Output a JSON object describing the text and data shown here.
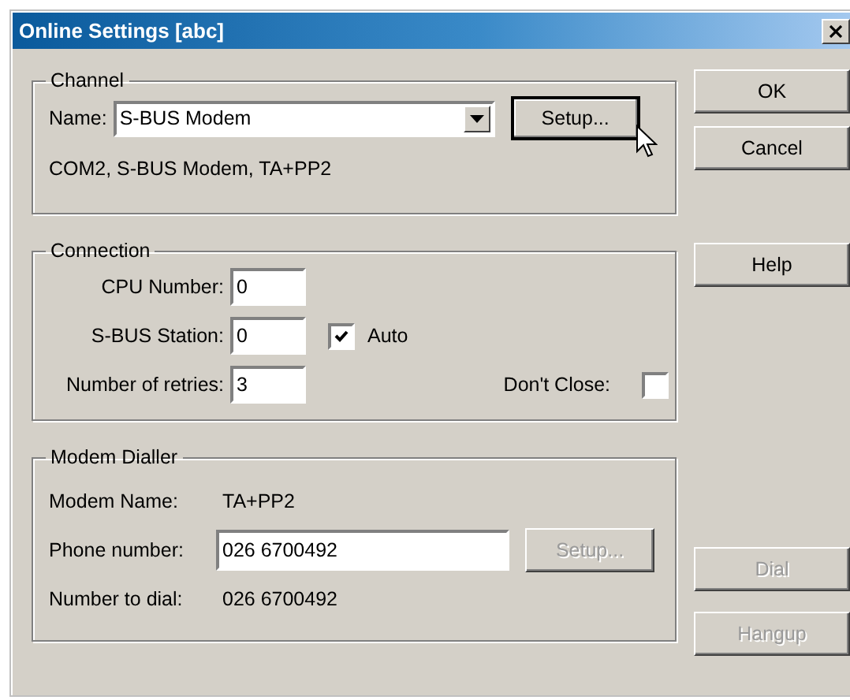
{
  "window": {
    "title": "Online Settings [abc]"
  },
  "channel": {
    "legend": "Channel",
    "name_label": "Name:",
    "name_value": "S-BUS Modem",
    "setup_button": {
      "label": "Setup...",
      "disabled": false
    },
    "summary": "COM2, S-BUS Modem, TA+PP2"
  },
  "connection": {
    "legend": "Connection",
    "fields": [
      {
        "label": "CPU Number:",
        "value": "0"
      },
      {
        "label": "S-BUS Station:",
        "value": "0"
      },
      {
        "label": "Number of retries:",
        "value": "3"
      }
    ],
    "auto": {
      "label": "Auto",
      "checked": true
    },
    "dont_close": {
      "label": "Don't Close:",
      "checked": false
    }
  },
  "modem_dialler": {
    "legend": "Modem Dialler",
    "modem_name_label": "Modem Name:",
    "modem_name": "TA+PP2",
    "phone_label": "Phone number:",
    "phone_value": "026 6700492",
    "setup_button": {
      "label": "Setup...",
      "disabled": true
    },
    "dial_label": "Number to dial:",
    "dial_value": "026 6700492"
  },
  "buttons": [
    {
      "label": "OK",
      "disabled": false
    },
    {
      "label": "Cancel",
      "disabled": false
    },
    {
      "label": "Help",
      "disabled": false
    },
    {
      "label": "Dial",
      "disabled": true
    },
    {
      "label": "Hangup",
      "disabled": true
    }
  ]
}
